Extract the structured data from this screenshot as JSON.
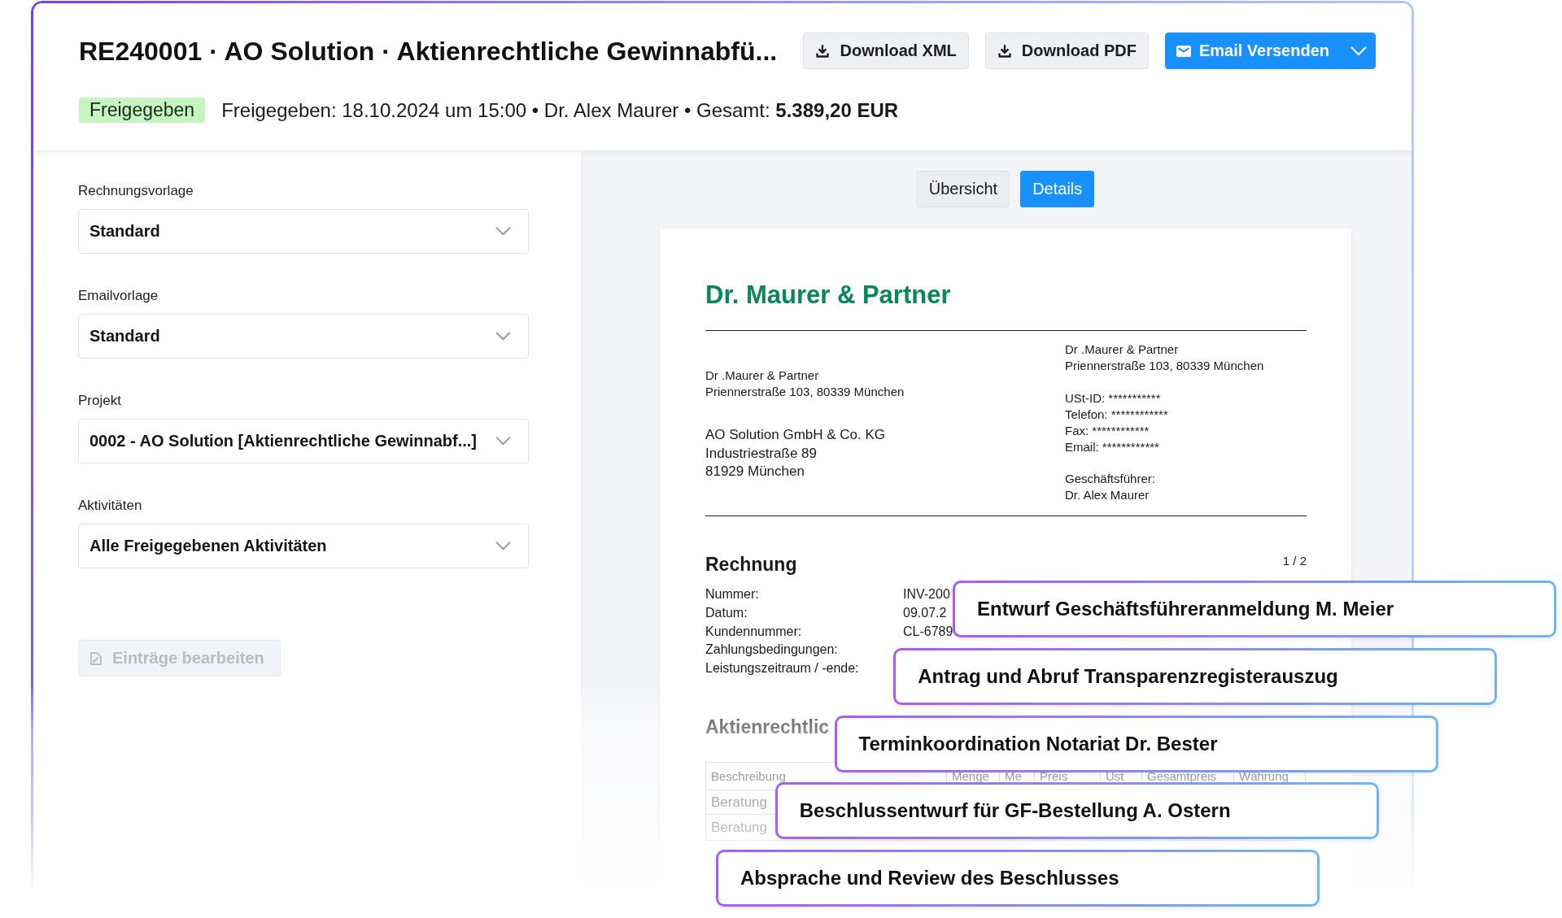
{
  "header": {
    "title": "RE240001 · AO Solution · Aktienrechtliche Gewinnabfü...",
    "actions": [
      {
        "kind": "download",
        "label": "Download XML"
      },
      {
        "kind": "download",
        "label": "Download PDF"
      },
      {
        "kind": "send",
        "label": "Email Versenden"
      }
    ],
    "status": "Freigegeben",
    "summary": "Freigegeben: 18.10.2024 um 15:00 • Dr. Alex Maurer • Gesamt: **5.389,20 EUR**"
  },
  "settings": {
    "fields": [
      {
        "label": "Rechnungsvorlage",
        "value": "Standard"
      },
      {
        "label": "Emailvorlage",
        "value": "Standard"
      },
      {
        "label": "Projekt",
        "value": "0002 - AO Solution [Aktienrechtliche Gewinnabf...]"
      },
      {
        "label": "Aktivitäten",
        "value": "Alle Freigegebenen Aktivitäten"
      }
    ],
    "edit_button": {
      "label": "Einträge bearbeiten",
      "disabled": true
    }
  },
  "preview": {
    "tabs": [
      {
        "label": "Übersicht",
        "selected": false
      },
      {
        "label": "Details",
        "selected": true
      }
    ],
    "document": {
      "company": "Dr. Maurer & Partner",
      "sender": [
        "Dr .Maurer & Partner",
        "Priennerstraße 103, 80339 München"
      ],
      "recipient": [
        "AO Solution GmbH & Co. KG",
        "Industriestraße 89",
        "81929 München"
      ],
      "letterhead": [
        [
          "Dr .Maurer & Partner",
          "Priennerstraße 103, 80339 München"
        ],
        [
          "USt-ID: ***********",
          "Telefon: ************",
          "Fax: ************",
          "Email: ************"
        ],
        [
          "Geschäftsführer:",
          "Dr. Alex Maurer"
        ]
      ],
      "heading": "Rechnung",
      "page": "1 / 2",
      "meta": [
        {
          "label": "Nummer:",
          "value": "INV-200"
        },
        {
          "label": "Datum:",
          "value": "09.07.2"
        },
        {
          "label": "Kundennummer:",
          "value": "CL-6789"
        },
        {
          "label": "Zahlungsbedingungen:"
        },
        {
          "label": "Leistungszeitraum / -ende:"
        }
      ],
      "section_title": "Aktienrechtlic",
      "table": {
        "columns": [
          "Beschreibung",
          "Menge",
          "Me",
          "Preis",
          "Ust",
          "Gesamtpreis",
          "Währung"
        ],
        "rows": [
          [
            "Beratung"
          ],
          [
            "Beratung"
          ]
        ]
      }
    }
  },
  "activities": [
    "Entwurf Geschäftsführeranmeldung M. Meier",
    "Antrag und Abruf Transparenzregisterauszug",
    "Terminkoordination Notariat Dr. Bester",
    "Beschlussentwurf für GF-Bestellung A. Ostern",
    "Absprache und Review des Beschlusses"
  ]
}
